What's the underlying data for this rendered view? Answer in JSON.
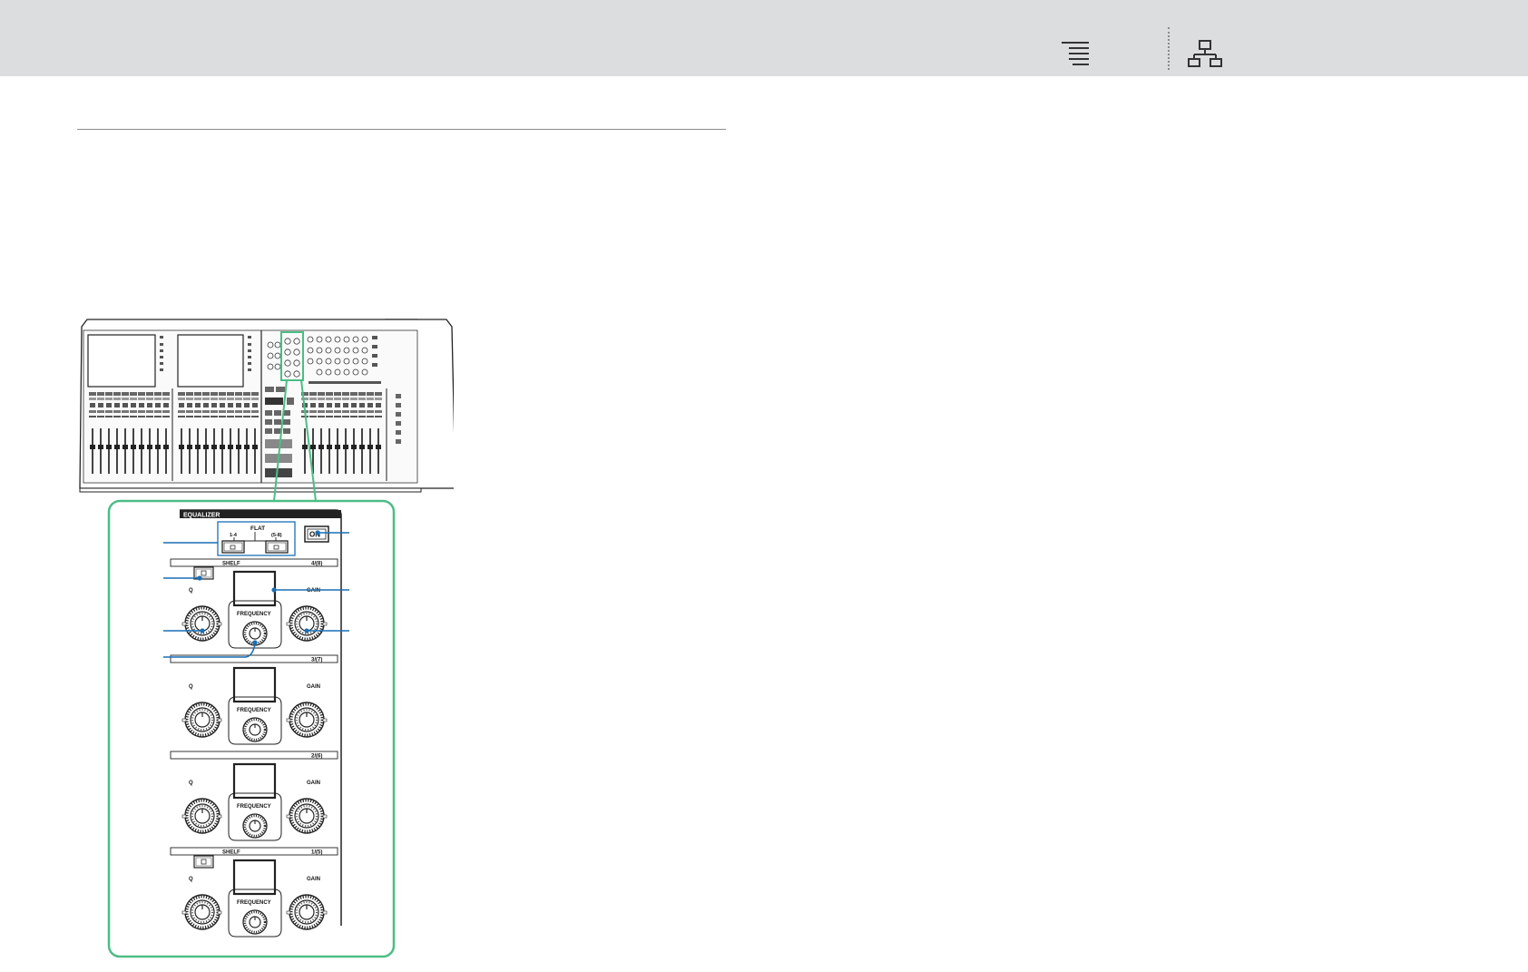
{
  "toolbar": {
    "buttons": [
      {
        "icon": "table-of-contents-icon"
      },
      {
        "icon": "site-map-icon"
      }
    ]
  },
  "figure": {
    "panel_title": "EQUALIZER",
    "flat_label": "FLAT",
    "flat_left_label": "1-4",
    "flat_right_label": "(5-8)",
    "on_label": "ON",
    "bands": [
      {
        "label": "4/(8)",
        "shelf": "SHELF",
        "q": "Q",
        "frequency": "FREQUENCY",
        "gain": "GAIN"
      },
      {
        "label": "3/(7)",
        "shelf": "",
        "q": "Q",
        "frequency": "FREQUENCY",
        "gain": "GAIN"
      },
      {
        "label": "2/(6)",
        "shelf": "",
        "q": "Q",
        "frequency": "FREQUENCY",
        "gain": "GAIN"
      },
      {
        "label": "1/(5)",
        "shelf": "SHELF",
        "q": "Q",
        "frequency": "FREQUENCY",
        "gain": "GAIN"
      }
    ],
    "highlight_color": "#4bbd85",
    "callout_color": "#1a6fb5"
  }
}
